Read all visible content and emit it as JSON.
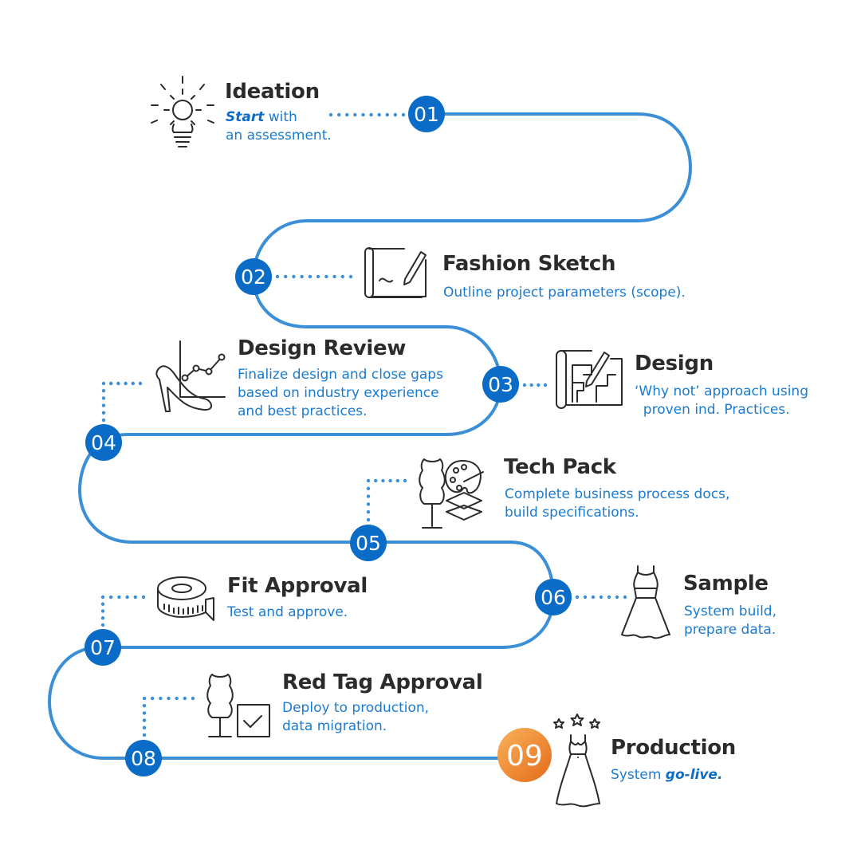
{
  "colors": {
    "path": "#3a8fd6",
    "badge": "#0a6cc6",
    "badge_final_start": "#f7a24a",
    "badge_final_end": "#e8731f",
    "title": "#2b2b2b",
    "description": "#1a7bcf",
    "dots": "#3a8fd6"
  },
  "steps": [
    {
      "number": "01",
      "title": "Ideation",
      "desc_emphasis": "Start",
      "desc_lines": [
        " with",
        "an assessment."
      ],
      "icon": "lightbulb-gear-icon"
    },
    {
      "number": "02",
      "title": "Fashion Sketch",
      "desc_lines": [
        "Outline project parameters (scope)."
      ],
      "icon": "sketch-scroll-icon"
    },
    {
      "number": "03",
      "title": "Design",
      "desc_lines": [
        "‘Why not’ approach using",
        "  proven ind. Practices."
      ],
      "icon": "blueprint-icon"
    },
    {
      "number": "04",
      "title": "Design Review",
      "desc_lines": [
        "Finalize design and close gaps",
        "based on industry experience",
        "and best practices."
      ],
      "icon": "high-heel-chart-icon"
    },
    {
      "number": "05",
      "title": "Tech Pack",
      "desc_lines": [
        "Complete business process docs,",
        "build specifications."
      ],
      "icon": "mannequin-palette-icon"
    },
    {
      "number": "06",
      "title": "Sample",
      "desc_lines": [
        "System build,",
        "prepare data."
      ],
      "icon": "dress-icon"
    },
    {
      "number": "07",
      "title": "Fit Approval",
      "desc_lines": [
        "Test and approve."
      ],
      "icon": "measuring-tape-icon"
    },
    {
      "number": "08",
      "title": "Red Tag Approval",
      "desc_lines": [
        "Deploy to production,",
        "data migration."
      ],
      "icon": "mannequin-checkbox-icon"
    },
    {
      "number": "09",
      "title": "Production",
      "desc_prefix": "System ",
      "desc_emphasis": "go-live.",
      "icon": "gown-stars-icon"
    }
  ]
}
